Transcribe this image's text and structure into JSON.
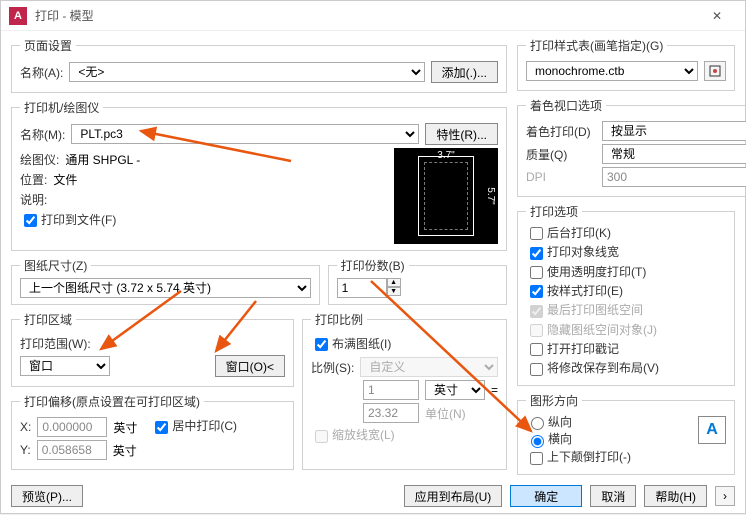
{
  "title": "打印 - 模型",
  "pageSetup": {
    "legend": "页面设置",
    "nameLabel": "名称(A):",
    "nameValue": "<无>",
    "addBtn": "添加(.)..."
  },
  "printer": {
    "legend": "打印机/绘图仪",
    "nameLabel": "名称(M):",
    "nameValue": "PLT.pc3",
    "propsBtn": "特性(R)...",
    "plotterLabel": "绘图仪:",
    "plotterValue": "通用 SHPGL -",
    "locationLabel": "位置:",
    "locationValue": "文件",
    "descLabel": "说明:",
    "toFileLabel": "打印到文件(F)",
    "dimH": "3.7\"",
    "dimV": "5.7\""
  },
  "paperSize": {
    "legend": "图纸尺寸(Z)",
    "value": "上一个图纸尺寸  (3.72 x 5.74 英寸)"
  },
  "copies": {
    "legend": "打印份数(B)",
    "value": "1"
  },
  "plotArea": {
    "legend": "打印区域",
    "rangeLabel": "打印范围(W):",
    "rangeValue": "窗口",
    "windowBtn": "窗口(O)<"
  },
  "scale": {
    "legend": "打印比例",
    "fitLabel": "布满图纸(I)",
    "scaleLabel": "比例(S):",
    "scaleValue": "自定义",
    "unit1": "1",
    "unit1Label": "英寸",
    "unit2": "23.32",
    "unit2Label": "单位(N)",
    "lineweightLabel": "缩放线宽(L)"
  },
  "offset": {
    "legend": "打印偏移(原点设置在可打印区域)",
    "xLabel": "X:",
    "xValue": "0.000000",
    "yLabel": "Y:",
    "yValue": "0.058658",
    "unit": "英寸",
    "centerLabel": "居中打印(C)"
  },
  "styleTable": {
    "legend": "打印样式表(画笔指定)(G)",
    "value": "monochrome.ctb"
  },
  "shadedViewport": {
    "legend": "着色视口选项",
    "shadeLabel": "着色打印(D)",
    "shadeValue": "按显示",
    "qualityLabel": "质量(Q)",
    "qualityValue": "常规",
    "dpiLabel": "DPI",
    "dpiValue": "300"
  },
  "options": {
    "legend": "打印选项",
    "o1": "后台打印(K)",
    "o2": "打印对象线宽",
    "o3": "使用透明度打印(T)",
    "o4": "按样式打印(E)",
    "o5": "最后打印图纸空间",
    "o6": "隐藏图纸空间对象(J)",
    "o7": "打开打印戳记",
    "o8": "将修改保存到布局(V)"
  },
  "orientation": {
    "legend": "图形方向",
    "portrait": "纵向",
    "landscape": "横向",
    "upsideDown": "上下颠倒打印(-)"
  },
  "footer": {
    "preview": "预览(P)...",
    "apply": "应用到布局(U)",
    "ok": "确定",
    "cancel": "取消",
    "help": "帮助(H)"
  }
}
